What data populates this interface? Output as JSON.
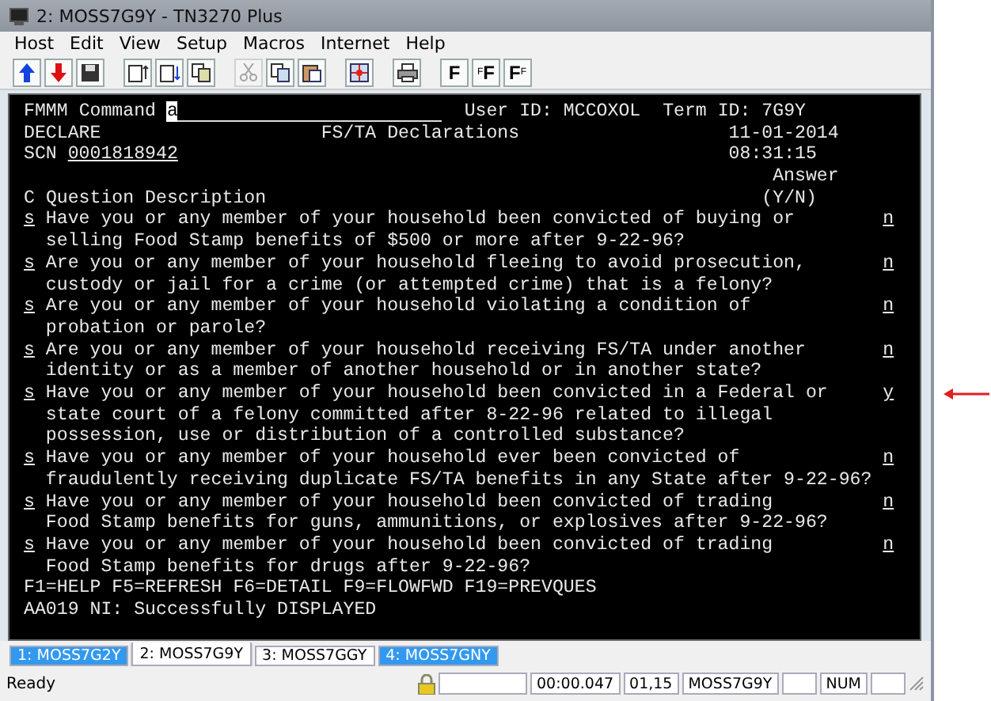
{
  "window": {
    "title": "2: MOSS7G9Y - TN3270 Plus"
  },
  "menu": [
    "Host",
    "Edit",
    "View",
    "Setup",
    "Macros",
    "Internet",
    "Help"
  ],
  "toolbar": [
    {
      "kind": "up"
    },
    {
      "kind": "down"
    },
    {
      "kind": "save"
    },
    {
      "kind": "sep"
    },
    {
      "kind": "doc1"
    },
    {
      "kind": "doc2"
    },
    {
      "kind": "doc3"
    },
    {
      "kind": "sep"
    },
    {
      "kind": "cut",
      "disabled": true
    },
    {
      "kind": "copy",
      "disabled": false
    },
    {
      "kind": "paste",
      "disabled": false
    },
    {
      "kind": "sep"
    },
    {
      "kind": "target"
    },
    {
      "kind": "sep"
    },
    {
      "kind": "print"
    },
    {
      "kind": "sep"
    },
    {
      "kind": "font",
      "big": "F"
    },
    {
      "kind": "font",
      "big": "F",
      "small_left": "F"
    },
    {
      "kind": "font",
      "big": "F",
      "small_right": "F"
    }
  ],
  "terminal": {
    "program": "FMMM",
    "command_label": "Command",
    "command_value": "a",
    "user_id": "User ID: MCCOXOL",
    "term_id": "Term ID: 7G9Y",
    "screen": "DECLARE",
    "screen_title": "FS/TA Declarations",
    "date": "11-01-2014",
    "scn_label": "SCN",
    "scn": "0001818942",
    "time": "08:31:15",
    "answer_header": "Answer",
    "answer_hint": "(Y/N)",
    "column_c": "C",
    "column_desc": "Question Description",
    "questions": [
      {
        "code": "s",
        "lines": [
          "Have you or any member of your household been convicted of buying or",
          "selling Food Stamp benefits of $500 or more after 9-22-96?"
        ],
        "answer": "n",
        "flagged": false
      },
      {
        "code": "s",
        "lines": [
          "Are you or any member of your household fleeing to avoid prosecution,",
          "custody or jail for a crime (or attempted crime) that is a felony?"
        ],
        "answer": "n",
        "flagged": false
      },
      {
        "code": "s",
        "lines": [
          "Are you or any member of your household violating a condition of",
          "probation or parole?"
        ],
        "answer": "n",
        "flagged": false
      },
      {
        "code": "s",
        "lines": [
          "Are you or any member of your household receiving FS/TA under another",
          "identity or as a member of another household or in another state?"
        ],
        "answer": "n",
        "flagged": false
      },
      {
        "code": "s",
        "lines": [
          "Have you or any member of your household been convicted in a Federal or",
          "state court of a felony committed after 8-22-96 related to illegal",
          "possession, use or distribution of a controlled substance?"
        ],
        "answer": "y",
        "flagged": true
      },
      {
        "code": "s",
        "lines": [
          "Have you or any member of your household ever been convicted of",
          "fraudulently receiving duplicate FS/TA benefits in any State after 9-22-96?"
        ],
        "answer": "n",
        "flagged": false
      },
      {
        "code": "s",
        "lines": [
          "Have you or any member of your household been convicted of trading",
          "Food Stamp benefits for guns, ammunitions, or explosives after 9-22-96?"
        ],
        "answer": "n",
        "flagged": false
      },
      {
        "code": "s",
        "lines": [
          "Have you or any member of your household been convicted of trading",
          "Food Stamp benefits for drugs after 9-22-96?"
        ],
        "answer": "n",
        "flagged": false
      }
    ],
    "function_keys": "F1=HELP F5=REFRESH F6=DETAIL F9=FLOWFWD F19=PREVQUES",
    "message": "AA019 NI: Successfully DISPLAYED"
  },
  "tabs": [
    {
      "label": "1: MOSS7G2Y",
      "selected": false,
      "color": "#3399ee"
    },
    {
      "label": "2: MOSS7G9Y",
      "selected": true,
      "color": "#ffffff"
    },
    {
      "label": "3: MOSS7GGY",
      "selected": false,
      "color": "#ffffff"
    },
    {
      "label": "4: MOSS7GNY",
      "selected": false,
      "color": "#3399ee"
    }
  ],
  "status_bar": {
    "status": "Ready",
    "locked": true,
    "fields": [
      {
        "kind": "blank"
      },
      {
        "kind": "text",
        "text": "00:00.047"
      },
      {
        "kind": "text",
        "text": "01,15"
      },
      {
        "kind": "text",
        "text": "MOSS7G9Y"
      },
      {
        "kind": "blank"
      },
      {
        "kind": "text",
        "text": "NUM"
      },
      {
        "kind": "blank"
      }
    ]
  }
}
